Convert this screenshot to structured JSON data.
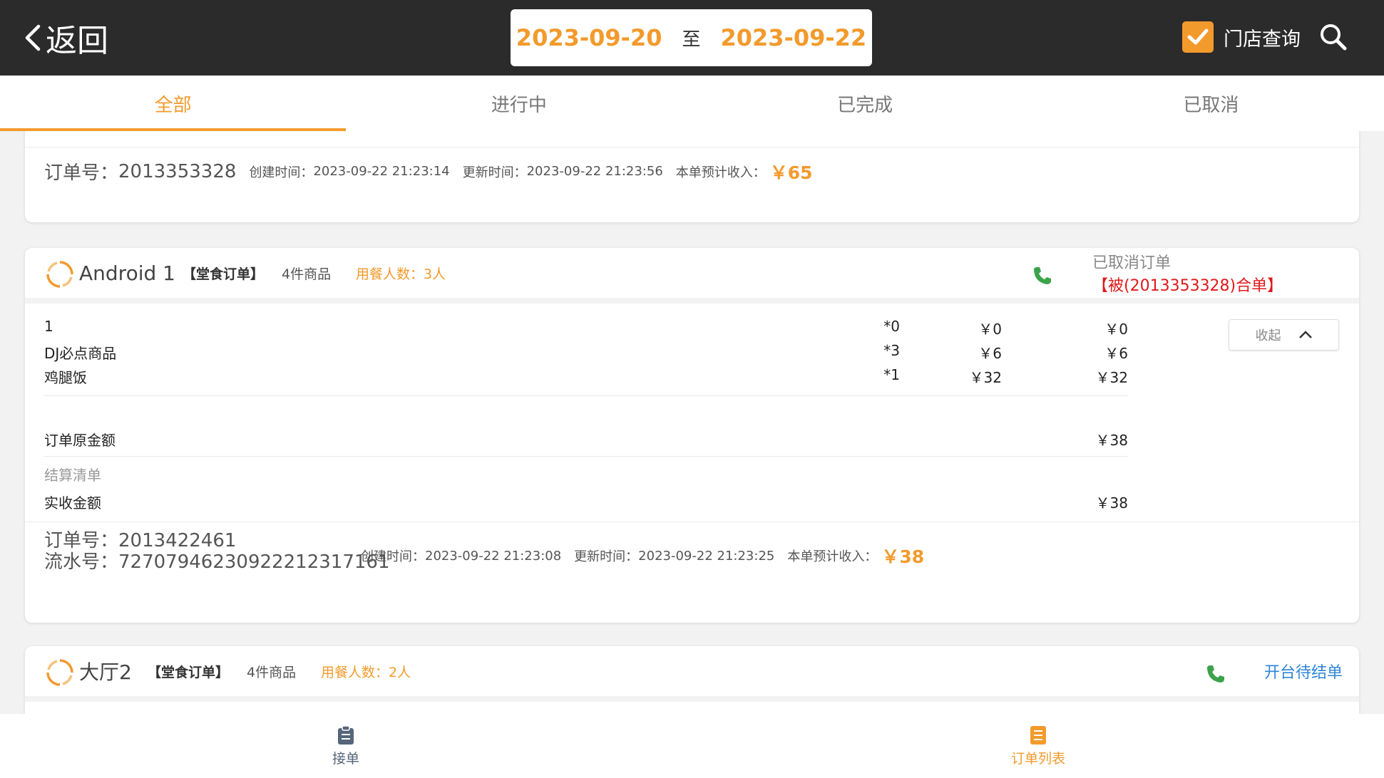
{
  "header": {
    "back_label": "返回",
    "date_start": "2023-09-20",
    "date_sep": "至",
    "date_end": "2023-09-22",
    "store_query_label": "门店查询",
    "store_query_checked": true,
    "accent_color": "#f39a2c"
  },
  "tabs": [
    {
      "label": "全部",
      "active": true
    },
    {
      "label": "进行中",
      "active": false
    },
    {
      "label": "已完成",
      "active": false
    },
    {
      "label": "已取消",
      "active": false
    }
  ],
  "orders": [
    {
      "order_no_label": "订单号：",
      "order_no": "2013353328",
      "created_label": "创建时间：",
      "created": "2023-09-22 21:23:14",
      "updated_label": "更新时间：",
      "updated": "2023-09-22 21:23:56",
      "income_label": "本单预计收入：",
      "income": "￥65"
    },
    {
      "table": "Android 1",
      "tag": "【堂食订单】",
      "count": "4件商品",
      "diners": "用餐人数：3人",
      "status": "已取消订单",
      "status_note": "【被(2013353328)合单】",
      "collapse_label": "收起",
      "items": [
        {
          "name": "1",
          "qty": "*0",
          "price": "￥0",
          "total": "￥0"
        },
        {
          "name": "DJ必点商品",
          "qty": "*3",
          "price": "￥6",
          "total": "￥6"
        },
        {
          "name": "鸡腿饭",
          "qty": "*1",
          "price": "￥32",
          "total": "￥32"
        }
      ],
      "original_amount_label": "订单原金额",
      "original_amount": "￥38",
      "settlement_label": "结算清单",
      "received_label": "实收金额",
      "received": "￥38",
      "order_no_label": "订单号：",
      "order_no": "2013422461",
      "serial_label": "流水号：",
      "serial": "727079462309222123171​61",
      "created_label": "创建时间：",
      "created": "2023-09-22 21:23:08",
      "updated_label": "更新时间：",
      "updated": "2023-09-22 21:23:25",
      "income_label": "本单预计收入：",
      "income": "￥38"
    },
    {
      "table": "大厅2",
      "tag": "【堂食订单】",
      "count": "4件商品",
      "diners": "用餐人数：2人",
      "status": "开台待结单"
    }
  ],
  "bottom_nav": [
    {
      "label": "接单",
      "active": false,
      "icon": "clipboard-icon"
    },
    {
      "label": "订单列表",
      "active": true,
      "icon": "list-icon"
    }
  ]
}
